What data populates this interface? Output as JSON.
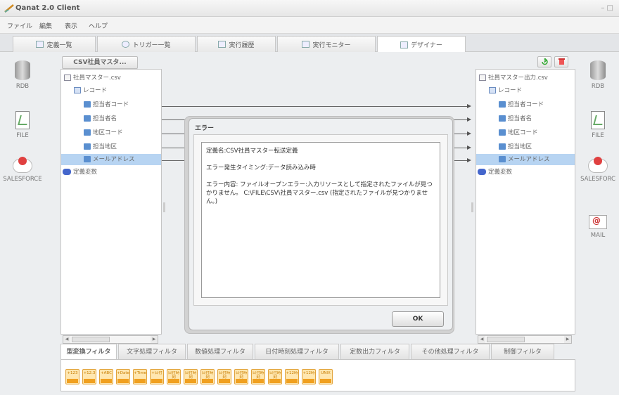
{
  "app": {
    "title": "Qanat 2.0 Client",
    "window_controls": "– □"
  },
  "menu": [
    "ファイル",
    "編集",
    "表示",
    "ヘルプ"
  ],
  "tabs": [
    {
      "label": "定義一覧",
      "icon": "list-icon"
    },
    {
      "label": "トリガー一覧",
      "icon": "clock-icon"
    },
    {
      "label": "実行履歴",
      "icon": "history-icon"
    },
    {
      "label": "実行モニター",
      "icon": "monitor-icon"
    },
    {
      "label": "デザイナー",
      "icon": "designer-icon",
      "active": true
    }
  ],
  "left_sidebar": [
    {
      "label": "RDB",
      "icon": "database-icon"
    },
    {
      "label": "FILE",
      "icon": "file-icon"
    },
    {
      "label": "SALESFORCE",
      "icon": "salesforce-cloud-icon"
    }
  ],
  "right_sidebar": [
    {
      "label": "RDB",
      "icon": "database-icon"
    },
    {
      "label": "FILE",
      "icon": "file-icon"
    },
    {
      "label": "SALESFORC",
      "icon": "salesforce-cloud-icon"
    },
    {
      "label": "MAIL",
      "icon": "mail-icon"
    }
  ],
  "source_panel": {
    "header_button": "CSV社員マスタ...",
    "tree": [
      {
        "label": "社員マスター.csv",
        "type": "file",
        "level": 0
      },
      {
        "label": "レコード",
        "type": "record",
        "level": 1
      },
      {
        "label": "担当者コード",
        "type": "field",
        "level": 2
      },
      {
        "label": "担当者名",
        "type": "field",
        "level": 2
      },
      {
        "label": "地区コード",
        "type": "field",
        "level": 2
      },
      {
        "label": "担当地区",
        "type": "field",
        "level": 2
      },
      {
        "label": "メールアドレス",
        "type": "field",
        "level": 2,
        "selected": true
      },
      {
        "label": "定義変数",
        "type": "variable",
        "level": 0
      }
    ]
  },
  "target_panel": {
    "tree": [
      {
        "label": "社員マスター出力.csv",
        "type": "file",
        "level": 0
      },
      {
        "label": "レコード",
        "type": "record",
        "level": 1
      },
      {
        "label": "担当者コード",
        "type": "field",
        "level": 2
      },
      {
        "label": "担当者名",
        "type": "field",
        "level": 2
      },
      {
        "label": "地区コード",
        "type": "field",
        "level": 2
      },
      {
        "label": "担当地区",
        "type": "field",
        "level": 2
      },
      {
        "label": "メールアドレス",
        "type": "field",
        "level": 2,
        "selected": true
      },
      {
        "label": "定義変数",
        "type": "variable",
        "level": 0
      }
    ]
  },
  "filter_tabs": [
    {
      "label": "型変換フィルタ",
      "active": true
    },
    {
      "label": "文字処理フィルタ"
    },
    {
      "label": "数値処理フィルタ"
    },
    {
      "label": "日付時刻処理フィルタ"
    },
    {
      "label": "定数出力フィルタ"
    },
    {
      "label": "その他処理フィルタ"
    },
    {
      "label": "制御フィルタ"
    }
  ],
  "filter_buttons": [
    "+123",
    "+12.3",
    "+ABC",
    "+Date",
    "+Time",
    "+日付",
    "日付時刻",
    "日付時刻",
    "日付時刻",
    "日付時刻",
    "日付時刻",
    "日付時刻",
    "日付時刻",
    "+12時",
    "+12時",
    "UNIX"
  ],
  "dialog": {
    "title": "エラー",
    "message": "定義名:CSV社員マスター転送定義\n\nエラー発生タイミング:データ読み込み時\n\nエラー内容: ファイルオープンエラー:入力リソースとして指定されたファイルが見つかりません。 C:\\FILE\\CSV\\社員マスター.csv (指定されたファイルが見つかりません。)",
    "ok_label": "OK"
  },
  "colors": {
    "selection": "#b7d4f2",
    "filter_accent": "#f0a020"
  }
}
